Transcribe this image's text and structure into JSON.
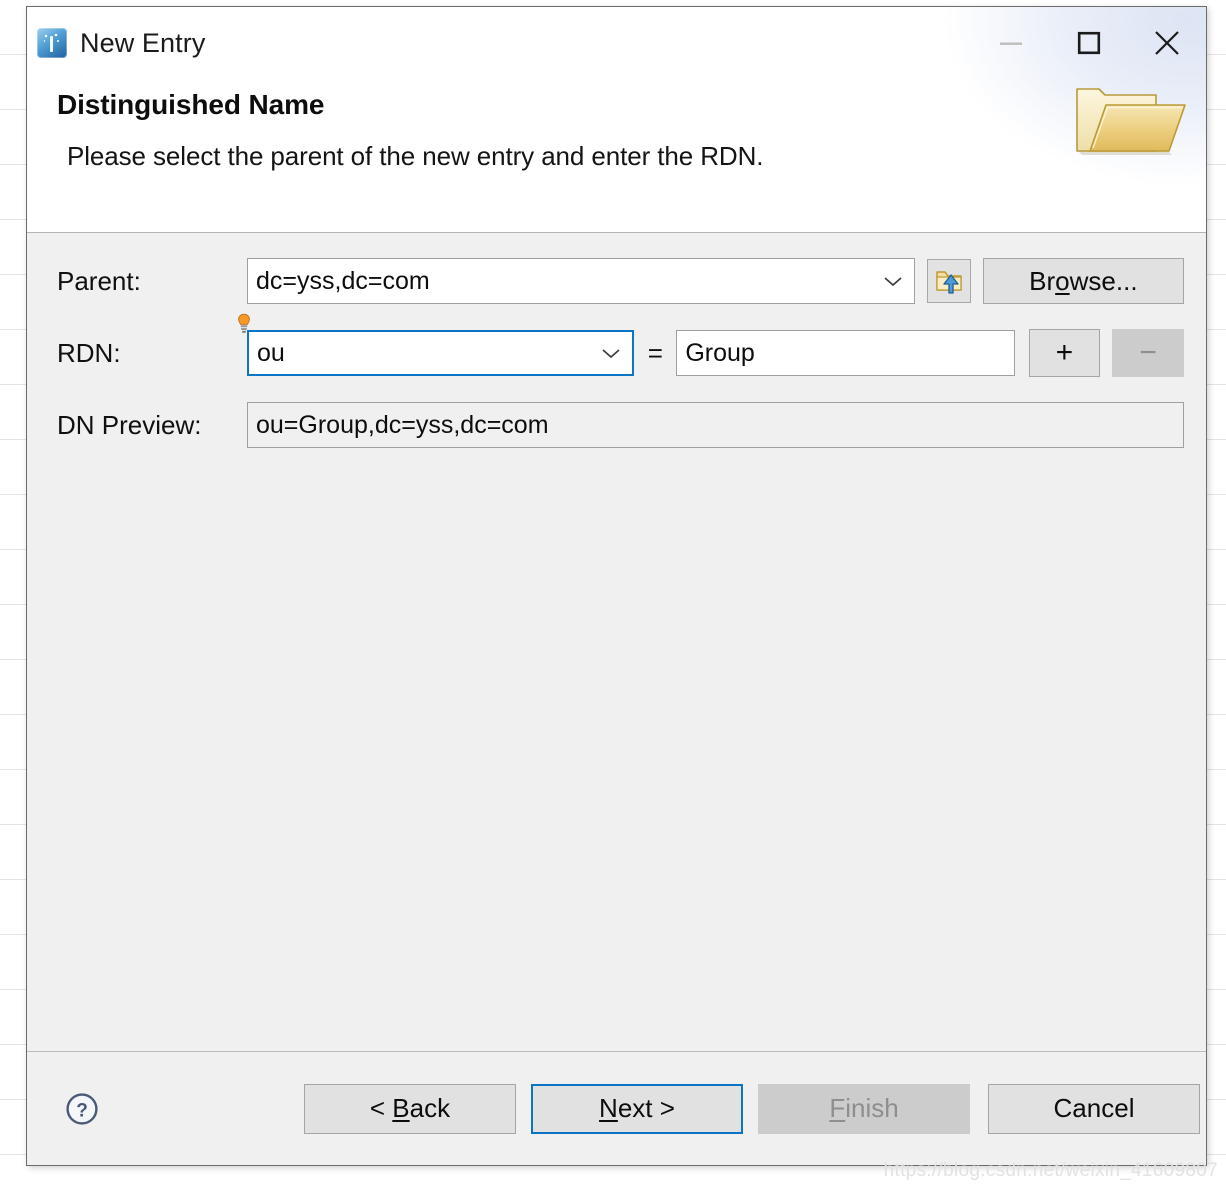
{
  "window": {
    "title": "New Entry",
    "icon": "entry-icon",
    "controls": {
      "minimize": "—",
      "maximize": "□",
      "close": "✕",
      "minimize_enabled": false
    }
  },
  "header": {
    "title": "Distinguished Name",
    "description": "Please select the parent of the new entry and enter the RDN.",
    "illustration": "open-folder-icon"
  },
  "form": {
    "parent": {
      "label": "Parent:",
      "value": "dc=yss,dc=com",
      "browse_label": "Browse...",
      "browse_mnemonic": "o",
      "pick_parent_icon": "folder-up-icon"
    },
    "rdn": {
      "label": "RDN:",
      "type_value": "ou",
      "equals": "=",
      "attribute_value": "Group",
      "add_label": "+",
      "remove_label": "−",
      "remove_enabled": false,
      "hint_icon": "content-assist-bulb-icon"
    },
    "dn_preview": {
      "label": "DN Preview:",
      "value": "ou=Group,dc=yss,dc=com"
    }
  },
  "footer": {
    "help_icon": "help-circle-icon",
    "buttons": [
      {
        "name": "back",
        "prefix": "< ",
        "mnemonic": "B",
        "rest": "ack",
        "suffix": "",
        "enabled": true,
        "focused": false
      },
      {
        "name": "next",
        "prefix": "",
        "mnemonic": "N",
        "rest": "ext",
        "suffix": " >",
        "enabled": true,
        "focused": true
      },
      {
        "name": "finish",
        "prefix": "",
        "mnemonic": "F",
        "rest": "inish",
        "suffix": "",
        "enabled": false,
        "focused": false
      },
      {
        "name": "cancel",
        "prefix": "",
        "mnemonic": "",
        "rest": "Cancel",
        "suffix": "",
        "enabled": true,
        "focused": false
      }
    ]
  },
  "watermark": "https://blog.csdn.net/weixin_41609807",
  "colors": {
    "accent_focus": "#0b74c4",
    "dialog_bg": "#f0f0f0",
    "header_bg": "#ffffff",
    "folder_gold": "#e2b14b",
    "bulb_orange": "#f0952a",
    "help_slate": "#4a5a76"
  }
}
